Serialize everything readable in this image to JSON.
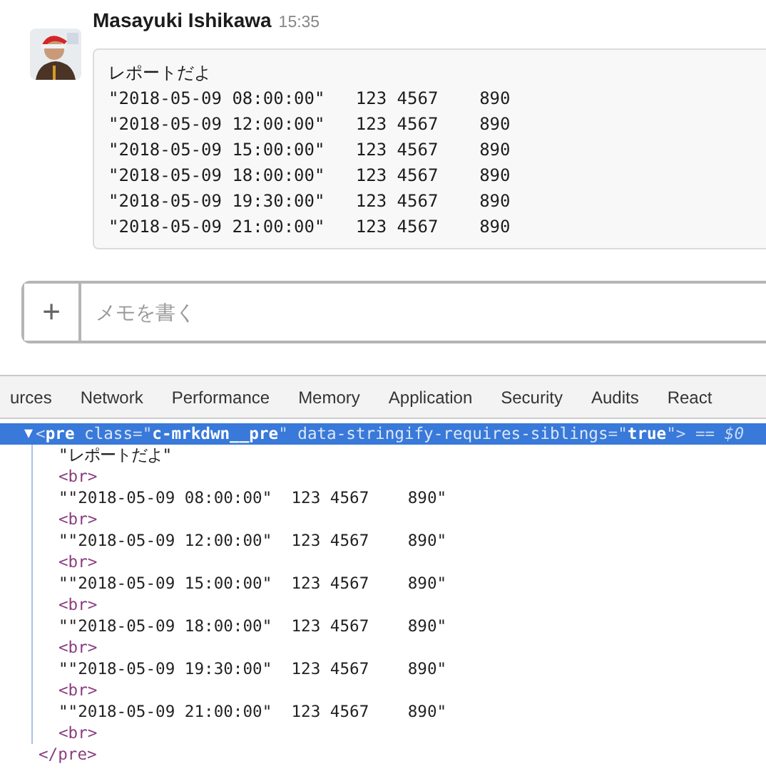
{
  "message": {
    "author": "Masayuki Ishikawa",
    "time": "15:35",
    "avatar": {
      "kind": "picture"
    },
    "lines": [
      "レポートだよ",
      "\"2018-05-09 08:00:00\"   123 4567    890",
      "\"2018-05-09 12:00:00\"   123 4567    890",
      "\"2018-05-09 15:00:00\"   123 4567    890",
      "\"2018-05-09 18:00:00\"   123 4567    890",
      "\"2018-05-09 19:30:00\"   123 4567    890",
      "\"2018-05-09 21:00:00\"   123 4567    890"
    ]
  },
  "composer": {
    "add_button": "+",
    "placeholder": "メモを書く"
  },
  "devtools": {
    "tabs": [
      "urces",
      "Network",
      "Performance",
      "Memory",
      "Application",
      "Security",
      "Audits",
      "React"
    ],
    "selected_node": {
      "arrow": "▼",
      "words": [
        [
          {
            "kind": "punct",
            "text": "<"
          },
          {
            "kind": "tag",
            "text": "pre"
          }
        ],
        [
          {
            "kind": "attr",
            "text": "class"
          },
          {
            "kind": "punct",
            "text": "=\""
          },
          {
            "kind": "value",
            "text": "c-mrkdwn__pre"
          },
          {
            "kind": "punct",
            "text": "\""
          }
        ],
        [
          {
            "kind": "attr",
            "text": "data-stringify-requires-siblings"
          },
          {
            "kind": "punct",
            "text": "=\""
          },
          {
            "kind": "value",
            "text": "true"
          },
          {
            "kind": "punct",
            "text": "\">"
          }
        ],
        [
          {
            "kind": "ref",
            "text": "== $0"
          }
        ]
      ]
    },
    "children": [
      {
        "kind": "text",
        "text": "\"レポートだよ\""
      },
      {
        "kind": "tag",
        "text": "<br>"
      },
      {
        "kind": "text",
        "text": "\"\"2018-05-09 08:00:00\"  123 4567    890\""
      },
      {
        "kind": "tag",
        "text": "<br>"
      },
      {
        "kind": "text",
        "text": "\"\"2018-05-09 12:00:00\"  123 4567    890\""
      },
      {
        "kind": "tag",
        "text": "<br>"
      },
      {
        "kind": "text",
        "text": "\"\"2018-05-09 15:00:00\"  123 4567    890\""
      },
      {
        "kind": "tag",
        "text": "<br>"
      },
      {
        "kind": "text",
        "text": "\"\"2018-05-09 18:00:00\"  123 4567    890\""
      },
      {
        "kind": "tag",
        "text": "<br>"
      },
      {
        "kind": "text",
        "text": "\"\"2018-05-09 19:30:00\"  123 4567    890\""
      },
      {
        "kind": "tag",
        "text": "<br>"
      },
      {
        "kind": "text",
        "text": "\"\"2018-05-09 21:00:00\"  123 4567    890\""
      },
      {
        "kind": "tag",
        "text": "<br>"
      }
    ],
    "closing_tag": "</pre>"
  }
}
